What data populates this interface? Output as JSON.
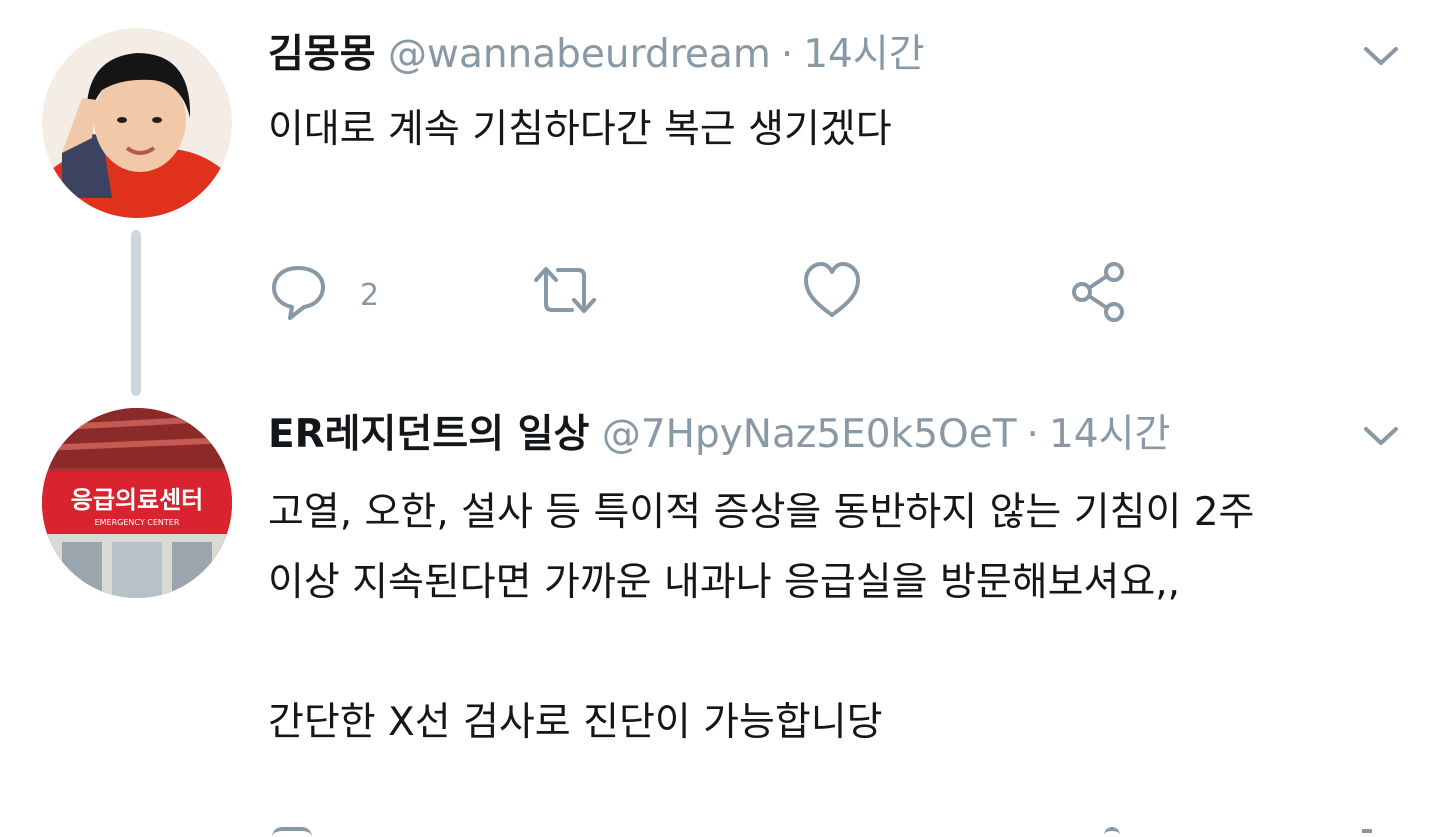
{
  "tweets": [
    {
      "display_name": "김몽몽",
      "handle": "@wannabeurdream",
      "dot": "·",
      "time": "14시간",
      "body": [
        "이대로 계속 기침하다간 복근 생기겠다"
      ],
      "reply_count": "2",
      "avatar": "child-portrait"
    },
    {
      "display_name": "ER레지던트의 일상",
      "handle": "@7HpyNaz5E0k5OeT",
      "dot": "·",
      "time": "14시간",
      "body": [
        "고열, 오한, 설사 등 특이적 증상을 동반하지 않는 기침이 2주",
        "이상 지속된다면 가까운 내과나 응급실을 방문해보셔요,,",
        "",
        "간단한 X선 검사로 진단이 가능합니당"
      ],
      "avatar": "emergency-center-sign",
      "sign_text": "응급의료센터",
      "sign_subtext": "EMERGENCY CENTER"
    }
  ],
  "colors": {
    "text": "#14171a",
    "secondary": "#8899a6",
    "thread_line": "#ccd6dd",
    "sign_red": "#d9232f"
  },
  "icons": [
    "reply-icon",
    "retweet-icon",
    "like-icon",
    "share-icon",
    "chevron-down-icon"
  ]
}
